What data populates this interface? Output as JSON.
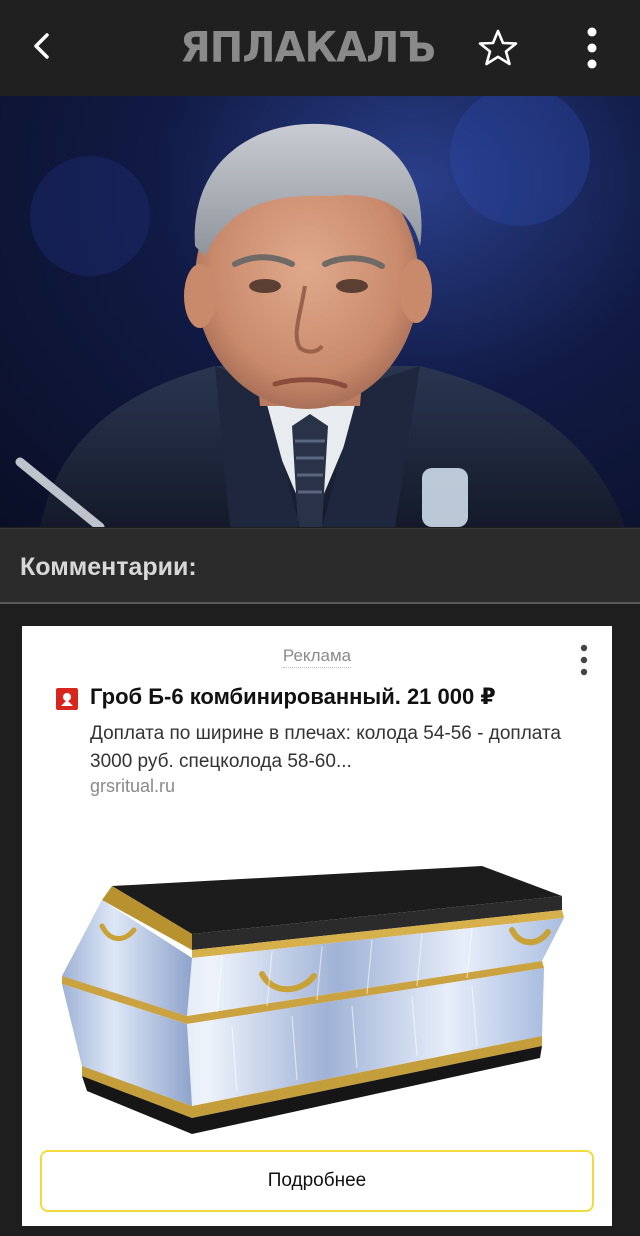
{
  "header": {
    "logo_text": "ЯПЛАКАЛЪ",
    "back_icon": "chevron-left-icon",
    "favorite_icon": "star-outline-icon",
    "menu_icon": "vertical-dots-icon"
  },
  "comments": {
    "title": "Комментарии:"
  },
  "ad": {
    "label": "Реклама",
    "headline": "Гроб Б-6 комбинированный. 21 000 ₽",
    "description": "Доплата по ширине в плечах: колода 54-56 - доплата 3000 руб. спецколода 58-60...",
    "domain": "grsritual.ru",
    "cta_label": "Подробнее",
    "cta_border_color": "#f2dc3d"
  }
}
